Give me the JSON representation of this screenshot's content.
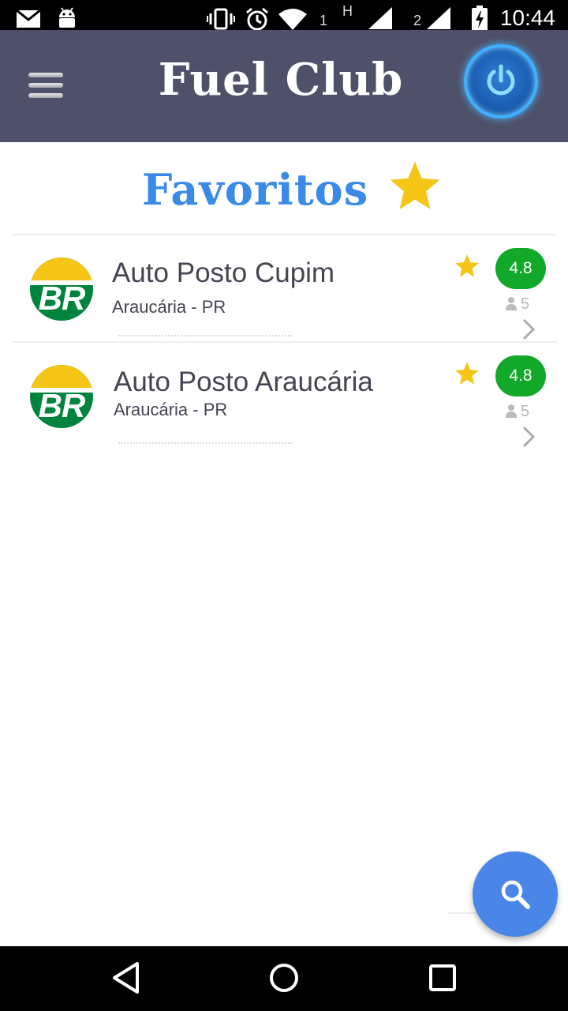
{
  "status_bar": {
    "time": "10:44",
    "sim1": "1",
    "sim2": "2",
    "network": "H",
    "icons": [
      "mail-icon",
      "android-icon",
      "vibrate-icon",
      "alarm-icon",
      "wifi-icon",
      "signal-icon",
      "battery-charging-icon"
    ]
  },
  "app_bar": {
    "title": "Fuel Club",
    "menu_icon": "hamburger-menu-icon",
    "power_icon": "power-icon"
  },
  "section": {
    "title": "Favoritos",
    "icon": "star-icon"
  },
  "stations": [
    {
      "name": "Auto Posto Cupim",
      "location": "Araucária - PR",
      "rating": "4.8",
      "reviews": "5",
      "brand": "BR"
    },
    {
      "name": "Auto Posto Araucária",
      "location": "Araucária - PR",
      "rating": "4.8",
      "reviews": "5",
      "brand": "BR"
    }
  ],
  "fab": {
    "icon": "search-icon"
  },
  "nav_bar": {
    "buttons": [
      "back-icon",
      "home-icon",
      "recents-icon"
    ]
  },
  "colors": {
    "app_bar": "#4f5069",
    "title_blue": "#3a8ae8",
    "star": "#f5c518",
    "rating_green": "#12a82a",
    "fab_blue": "#4a86e8"
  }
}
